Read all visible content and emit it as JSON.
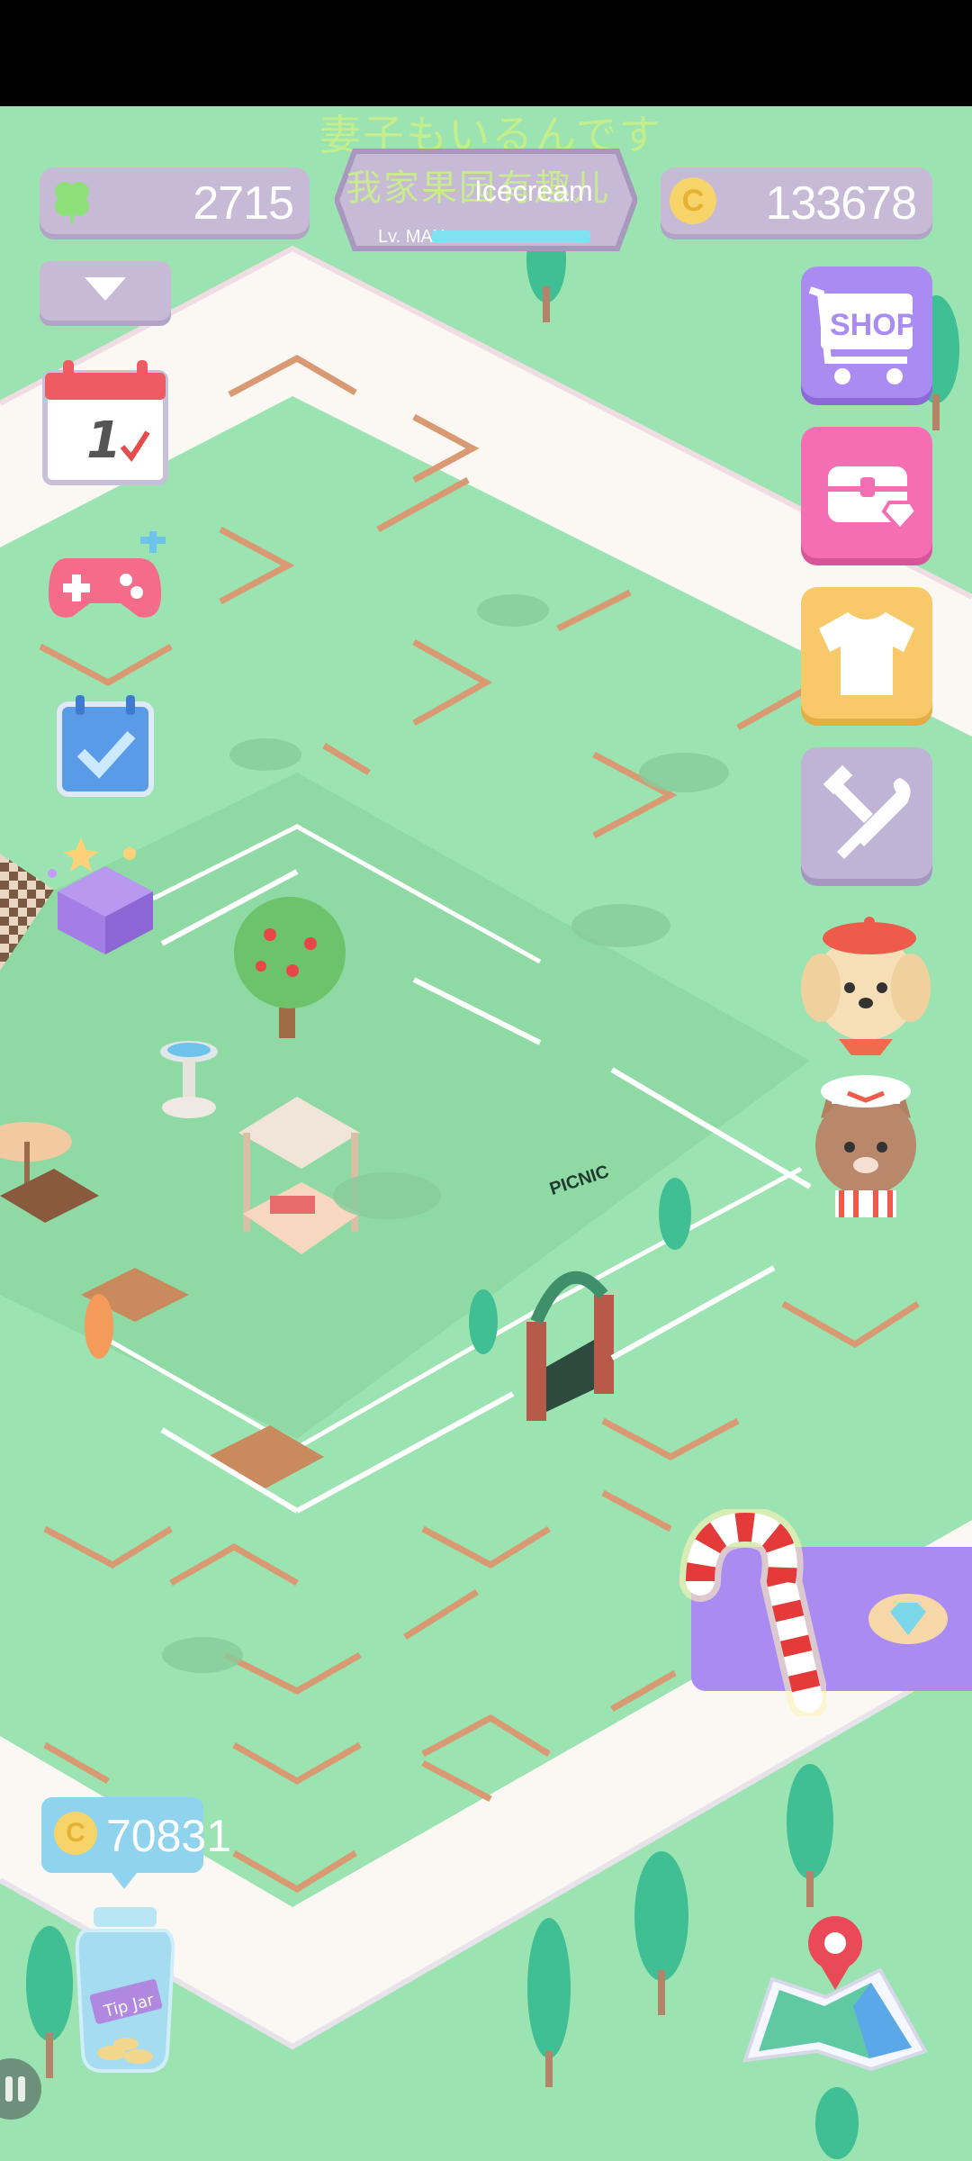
{
  "status_bar": {},
  "top_overlay": {
    "line1": "妻子もいるんです",
    "line2": "我家果园有趣儿"
  },
  "currency": {
    "clover_count": "2715",
    "coin_count": "133678",
    "clover_icon": "clover-icon",
    "coin_icon": "coin-icon"
  },
  "shop_name": {
    "title": "Icecream",
    "level": "Lv. MAX"
  },
  "left_menu": {
    "dropdown_icon": "triangle-down-icon",
    "calendar_day": "1",
    "items": [
      "calendar-icon",
      "gamepad-icon",
      "checklist-icon",
      "gift-box-icon"
    ]
  },
  "right_menu": {
    "shop_label": "SHOP",
    "items": [
      "shop-cart-icon",
      "treasure-chest-icon",
      "tshirt-icon",
      "tools-icon"
    ]
  },
  "characters": [
    "dog-character",
    "cat-chef-character"
  ],
  "picnic_sign": "PICNIC",
  "tip_jar": {
    "amount": "70831",
    "label": "Tip Jar"
  },
  "event_banner": {
    "icon": "candy-cane-icon",
    "reward_icon": "diamond-icon"
  },
  "colors": {
    "grass": "#9be3b0",
    "path": "#fbf7f3",
    "panel": "#c7bad6",
    "shop_purple": "#a98bf2",
    "chest_pink": "#f56eb3",
    "shirt_yellow": "#f7c96a",
    "tools_lilac": "#c0b4d6"
  }
}
